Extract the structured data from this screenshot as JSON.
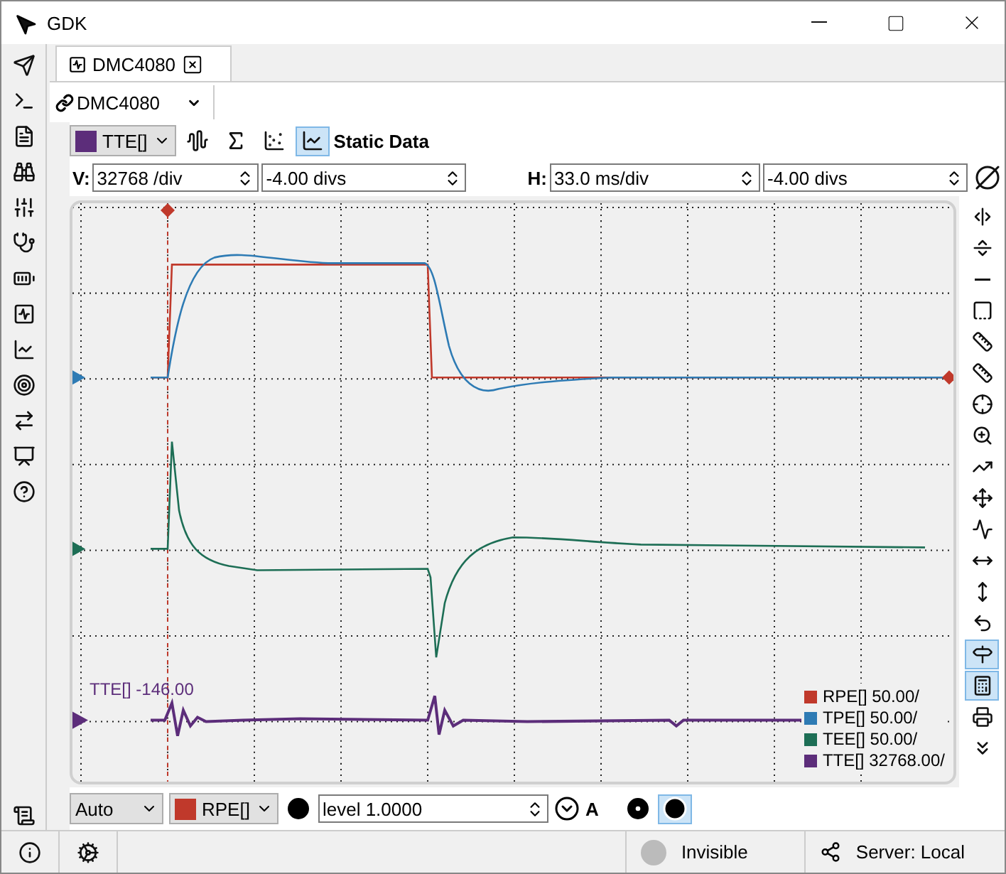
{
  "window": {
    "title": "GDK"
  },
  "left_tools": [
    {
      "kind": "pointer"
    },
    {
      "kind": "terminal"
    },
    {
      "kind": "document"
    },
    {
      "kind": "binoculars"
    },
    {
      "kind": "sliders"
    },
    {
      "kind": "stethoscope"
    },
    {
      "kind": "motor"
    },
    {
      "kind": "scope"
    },
    {
      "kind": "chart"
    },
    {
      "kind": "target"
    },
    {
      "kind": "transfer"
    },
    {
      "kind": "presenter"
    },
    {
      "kind": "help"
    }
  ],
  "left_bottom_tool": {
    "kind": "script"
  },
  "tab": {
    "label": "DMC4080",
    "selected": true
  },
  "device": {
    "label": "DMC4080"
  },
  "channel_select": {
    "label": "TTE[]",
    "color": "#5c2d7a"
  },
  "view_tools": [
    {
      "kind": "filter",
      "selected": false
    },
    {
      "kind": "function",
      "selected": false
    },
    {
      "kind": "scatter",
      "selected": false
    },
    {
      "kind": "line",
      "selected": true
    }
  ],
  "view_label": "Static Data",
  "vertical": {
    "label": "V:",
    "scale": "32768 /div",
    "offset": "-4.00 divs"
  },
  "horizontal": {
    "label": "H:",
    "scale": "33.0 ms/div",
    "offset": "-4.00 divs"
  },
  "plot": {
    "readout": "TTE[] -146.00",
    "legend": [
      {
        "label": "RPE[] 50.00/",
        "color": "#c0392b"
      },
      {
        "label": "TPE[] 50.00/",
        "color": "#2e7bb4"
      },
      {
        "label": "TEE[] 50.00/",
        "color": "#1d6e55"
      },
      {
        "label": "TTE[] 32768.00/",
        "color": "#5c2d7a"
      }
    ]
  },
  "right_tools": [
    {
      "kind": "cursor-v",
      "selected": false
    },
    {
      "kind": "cursor-h",
      "selected": false
    },
    {
      "kind": "cursor-dot",
      "selected": false
    },
    {
      "kind": "square-ruler",
      "selected": false
    },
    {
      "kind": "ruler-v",
      "selected": false
    },
    {
      "kind": "ruler-h",
      "selected": false
    },
    {
      "kind": "crosshair",
      "selected": false
    },
    {
      "kind": "zoom",
      "selected": false
    },
    {
      "kind": "trend",
      "selected": false
    },
    {
      "kind": "move",
      "selected": false
    },
    {
      "kind": "wave",
      "selected": false
    },
    {
      "kind": "stretch-h",
      "selected": false
    },
    {
      "kind": "stretch-v",
      "selected": false
    },
    {
      "kind": "undo",
      "selected": false
    },
    {
      "kind": "signpost",
      "selected": true
    },
    {
      "kind": "abacus",
      "selected": true
    },
    {
      "kind": "print",
      "selected": false
    },
    {
      "kind": "more",
      "selected": false
    }
  ],
  "trigger": {
    "mode": "Auto",
    "channel": {
      "label": "RPE[]",
      "color": "#c0392b"
    },
    "level": "level 1.0000",
    "edge_label": "A",
    "run_selected": true
  },
  "status_bar": {
    "visibility": "Invisible",
    "server": "Server: Local"
  }
}
